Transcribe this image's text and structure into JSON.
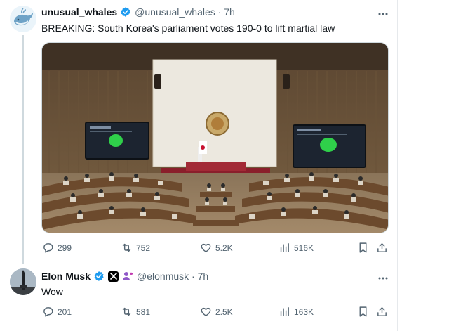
{
  "tweets": [
    {
      "display_name": "unusual_whales",
      "handle_time": "@unusual_whales · 7h",
      "text": "BREAKING: South Korea's parliament votes 190-0 to lift martial law",
      "actions": {
        "replies": "299",
        "reposts": "752",
        "likes": "5.2K",
        "views": "516K"
      }
    },
    {
      "display_name": "Elon Musk",
      "handle_time": "@elonmusk · 7h",
      "text": "Wow",
      "actions": {
        "replies": "201",
        "reposts": "581",
        "likes": "2.5K",
        "views": "163K"
      }
    }
  ],
  "colors": {
    "verified": "#1d9bf0",
    "muted": "#536471",
    "divider": "#e6e9ec"
  },
  "icons": [
    "whale-avatar",
    "verified-icon",
    "more-icon",
    "reply-icon",
    "repost-icon",
    "like-icon",
    "views-icon",
    "bookmark-icon",
    "share-icon",
    "x-badge-icon",
    "person-icon"
  ]
}
